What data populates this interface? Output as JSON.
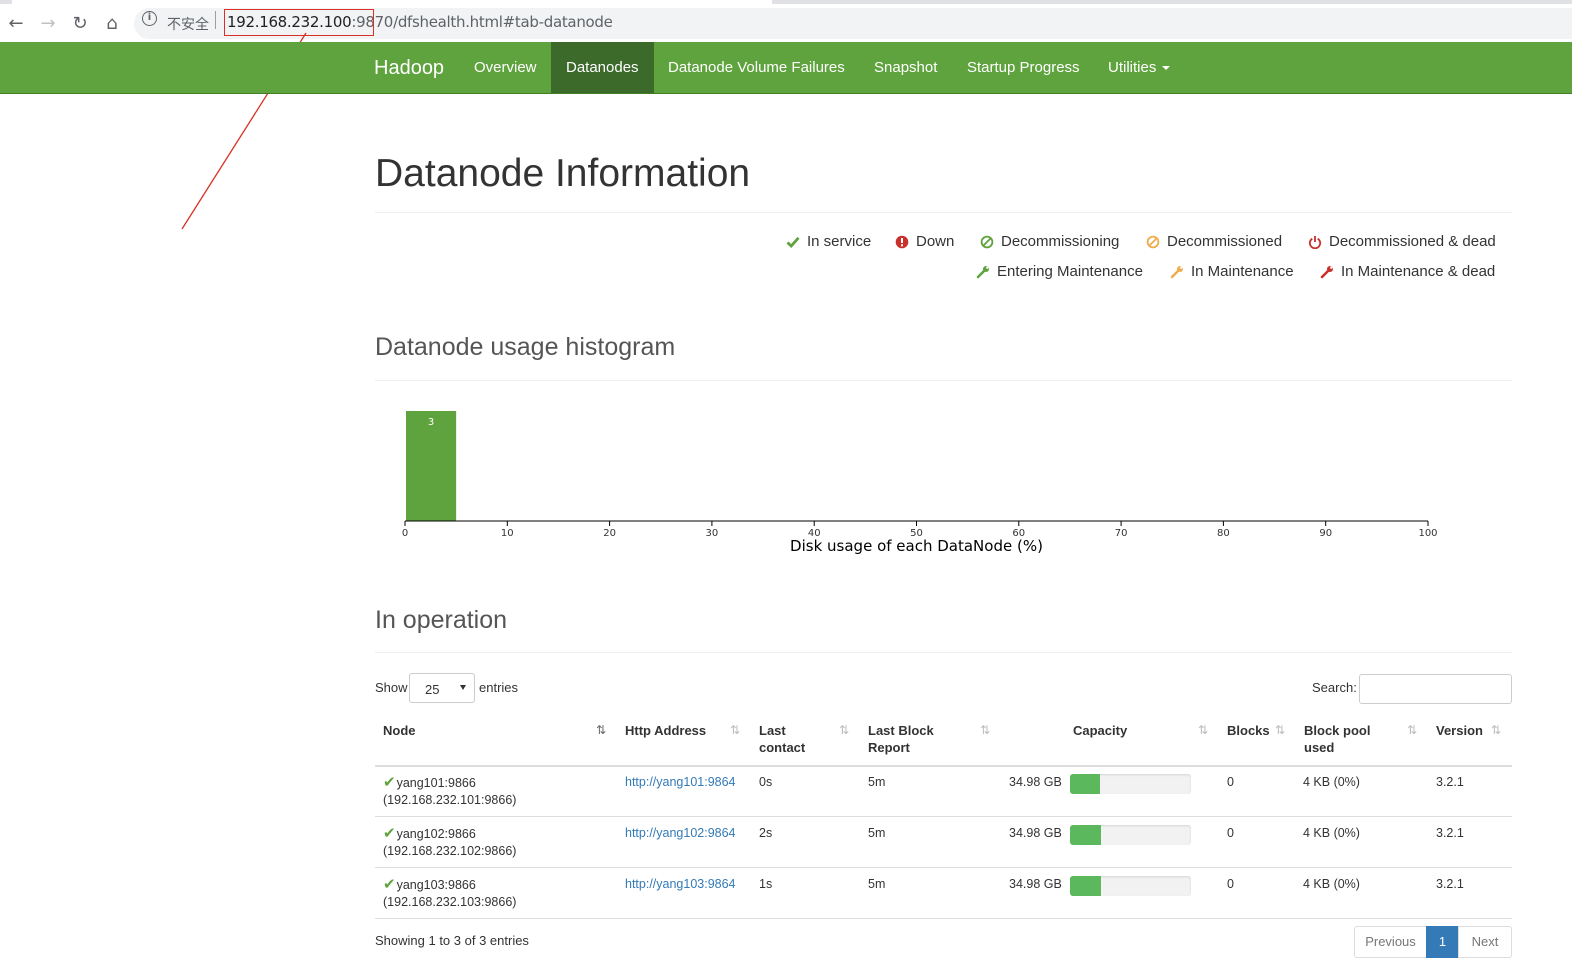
{
  "browser": {
    "back_icon": "arrow-left-icon",
    "forward_icon": "arrow-right-icon",
    "reload_icon": "reload-icon",
    "home_icon": "home-icon",
    "info_icon": "info-icon",
    "info_glyph": "i",
    "insecure_label": "不安全",
    "url_host": "192.168.232.100",
    "url_port": ":9870",
    "url_path": "/dfshealth.html#tab-datanode",
    "annotation_color": "#d93025"
  },
  "navbar": {
    "brand": "Hadoop",
    "items": [
      {
        "label": "Overview"
      },
      {
        "label": "Datanodes",
        "active": true
      },
      {
        "label": "Datanode Volume Failures"
      },
      {
        "label": "Snapshot"
      },
      {
        "label": "Startup Progress"
      },
      {
        "label": "Utilities",
        "dropdown": true
      }
    ],
    "color": "#5fa33e",
    "active_color": "#3b6a2a"
  },
  "page_title": "Datanode Information",
  "legend": [
    {
      "label": "In service",
      "icon": "check-icon",
      "color": "#5fa33e"
    },
    {
      "label": "Down",
      "icon": "exclamation-circle-icon",
      "color": "#c9302c"
    },
    {
      "label": "Decommissioning",
      "icon": "ban-circle-icon",
      "color": "#5fa33e"
    },
    {
      "label": "Decommissioned",
      "icon": "ban-circle-icon",
      "color": "#f0ad4e"
    },
    {
      "label": "Decommissioned & dead",
      "icon": "power-icon",
      "color": "#c9302c"
    },
    {
      "label": "Entering Maintenance",
      "icon": "wrench-icon",
      "color": "#5fa33e"
    },
    {
      "label": "In Maintenance",
      "icon": "wrench-icon",
      "color": "#f0ad4e"
    },
    {
      "label": "In Maintenance & dead",
      "icon": "wrench-icon",
      "color": "#c9302c"
    }
  ],
  "histogram_title": "Datanode usage histogram",
  "chart_data": {
    "type": "bar",
    "title": "",
    "xlabel": "Disk usage of each DataNode (%)",
    "ylabel": "",
    "xlim": [
      0,
      100
    ],
    "xticks": [
      "0",
      "10",
      "20",
      "30",
      "40",
      "50",
      "60",
      "70",
      "80",
      "90",
      "100"
    ],
    "bins": [
      {
        "start": 0,
        "end": 5,
        "count": 3
      }
    ],
    "bar_color": "#5fa33e",
    "grid": false
  },
  "operation": {
    "title": "In operation",
    "show_label": "Show",
    "entries_value": "25",
    "entries_label": "entries",
    "search_label": "Search:",
    "search_value": "",
    "columns": [
      {
        "line1": "",
        "line2": "Node"
      },
      {
        "line1": "",
        "line2": "Http Address"
      },
      {
        "line1": "Last",
        "line2": "contact"
      },
      {
        "line1": "Last Block",
        "line2": "Report"
      },
      {
        "line1": "",
        "line2": "Capacity"
      },
      {
        "line1": "",
        "line2": "Blocks"
      },
      {
        "line1": "Block pool",
        "line2": "used"
      },
      {
        "line1": "",
        "line2": "Version"
      }
    ],
    "sort_glyph": "⇅",
    "rows": [
      {
        "status_icon": "check-icon",
        "status_glyph": "✔",
        "node": "yang101:9866",
        "node_ip": "(192.168.232.101:9866)",
        "http": "http://yang101:9864",
        "last_contact": "0s",
        "last_block_report": "5m",
        "capacity": "34.98 GB",
        "usage_pct": 25,
        "blocks": "0",
        "block_pool_used": "4 KB (0%)",
        "version": "3.2.1"
      },
      {
        "status_icon": "check-icon",
        "status_glyph": "✔",
        "node": "yang102:9866",
        "node_ip": "(192.168.232.102:9866)",
        "http": "http://yang102:9864",
        "last_contact": "2s",
        "last_block_report": "5m",
        "capacity": "34.98 GB",
        "usage_pct": 26,
        "blocks": "0",
        "block_pool_used": "4 KB (0%)",
        "version": "3.2.1"
      },
      {
        "status_icon": "check-icon",
        "status_glyph": "✔",
        "node": "yang103:9866",
        "node_ip": "(192.168.232.103:9866)",
        "http": "http://yang103:9864",
        "last_contact": "1s",
        "last_block_report": "5m",
        "capacity": "34.98 GB",
        "usage_pct": 26,
        "blocks": "0",
        "block_pool_used": "4 KB (0%)",
        "version": "3.2.1"
      }
    ],
    "summary": "Showing 1 to 3 of 3 entries",
    "pagination": {
      "previous": "Previous",
      "current": "1",
      "next": "Next"
    }
  }
}
